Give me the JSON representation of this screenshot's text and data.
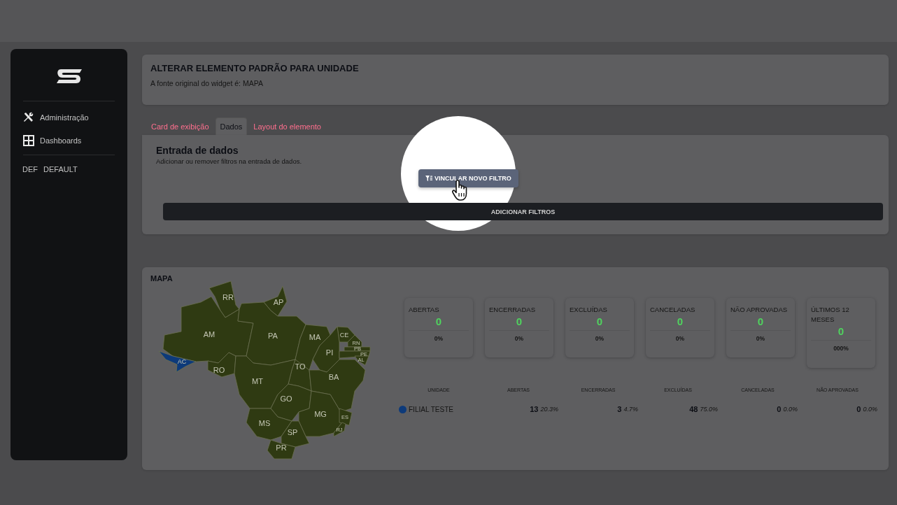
{
  "sidebar": {
    "items": [
      {
        "label": "Administração"
      },
      {
        "label": "Dashboards"
      }
    ],
    "workspace": {
      "code": "DEF",
      "label": "DEFAULT"
    }
  },
  "header": {
    "title": "ALTERAR ELEMENTO PADRÃO PARA UNIDADE",
    "subtitle": "A fonte original do widget é: MAPA"
  },
  "tabs": [
    {
      "label": "Card de exibição",
      "selected": false
    },
    {
      "label": "Dados",
      "selected": true
    },
    {
      "label": "Layout do elemento",
      "selected": false
    }
  ],
  "data_panel": {
    "title": "Entrada de dados",
    "description": "Adicionar ou remover filtros na entrada de dados.",
    "link_button": "VINCULAR NOVO FILTRO",
    "add_button": "ADICIONAR FILTROS"
  },
  "map_panel": {
    "title": "MAPA",
    "states": [
      {
        "label": "RR",
        "color": "#2f3a12"
      },
      {
        "label": "AP",
        "color": "#2f3a12"
      },
      {
        "label": "AM",
        "color": "#2f3a12"
      },
      {
        "label": "PA",
        "color": "#2f3a12"
      },
      {
        "label": "MA",
        "color": "#2f3a12"
      },
      {
        "label": "CE",
        "color": "#2f3a12"
      },
      {
        "label": "RN",
        "color": "#2f3a12"
      },
      {
        "label": "PB",
        "color": "#2f3a12"
      },
      {
        "label": "PE",
        "color": "#2f3a12"
      },
      {
        "label": "AL",
        "color": "#2f3a12"
      },
      {
        "label": "PI",
        "color": "#2f3a12"
      },
      {
        "label": "AC",
        "color": "#0d3a7a"
      },
      {
        "label": "RO",
        "color": "#2f3a12"
      },
      {
        "label": "TO",
        "color": "#2f3a12"
      },
      {
        "label": "MT",
        "color": "#2f3a12"
      },
      {
        "label": "BA",
        "color": "#2f3a12"
      },
      {
        "label": "GO",
        "color": "#2f3a12"
      },
      {
        "label": "MG",
        "color": "#2f3a12"
      },
      {
        "label": "ES",
        "color": "#2f3a12"
      },
      {
        "label": "MS",
        "color": "#2f3a12"
      },
      {
        "label": "SP",
        "color": "#2f3a12"
      },
      {
        "label": "RJ",
        "color": "#2f3a12"
      },
      {
        "label": "PR",
        "color": "#2f3a12"
      }
    ],
    "stats": [
      {
        "label": "ABERTAS",
        "value": "0",
        "percent": "0%"
      },
      {
        "label": "ENCERRADAS",
        "value": "0",
        "percent": "0%"
      },
      {
        "label": "EXCLUÍDAS",
        "value": "0",
        "percent": "0%"
      },
      {
        "label": "CANCELADAS",
        "value": "0",
        "percent": "0%"
      },
      {
        "label": "NÃO APROVADAS",
        "value": "0",
        "percent": "0%"
      },
      {
        "label": "ÚLTIMOS 12 MESES",
        "value": "0",
        "percent": "000%"
      }
    ],
    "table": {
      "columns": [
        "UNIDADE",
        "ABERTAS",
        "ENCERRADAS",
        "EXCLUÍDAS",
        "CANCELADAS",
        "NÃO APROVADAS"
      ],
      "rows": [
        {
          "color": "#0d3a7a",
          "unit": "FILIAL TESTE",
          "cells": [
            {
              "value": "13",
              "percent": "20.3%"
            },
            {
              "value": "3",
              "percent": "4.7%"
            },
            {
              "value": "48",
              "percent": "75.0%"
            },
            {
              "value": "0",
              "percent": "0.0%"
            },
            {
              "value": "0",
              "percent": "0.0%"
            }
          ]
        }
      ]
    }
  }
}
